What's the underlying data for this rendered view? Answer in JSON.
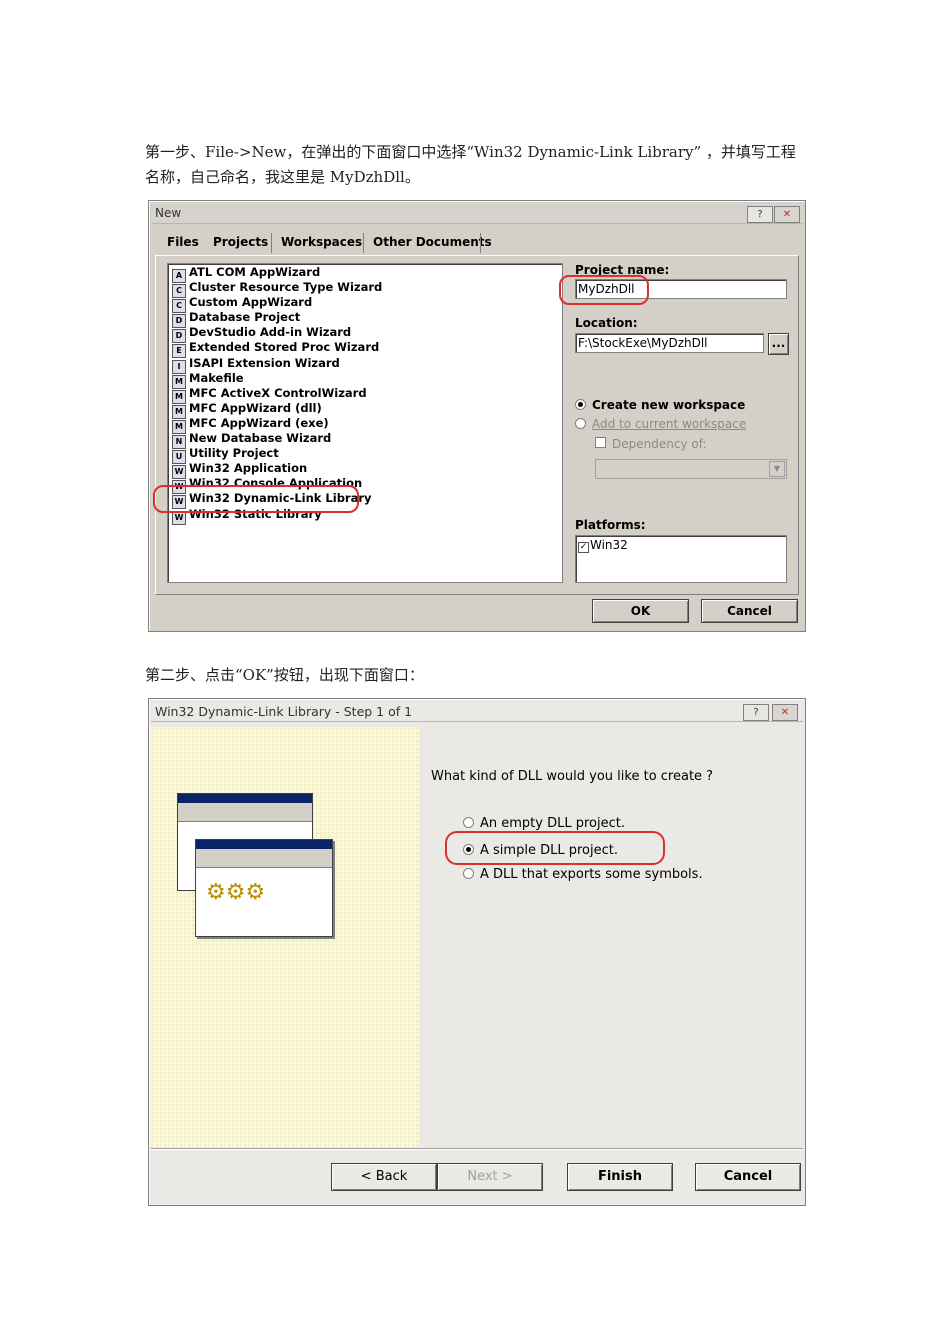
{
  "step1_text": "第一步、File->New，在弹出的下面窗口中选择“Win32 Dynamic-Link Library” ，并填写工程名称，自己命名，我这里是 MyDzhDll。",
  "step2_text": "第二步、点击“OK”按钮，出现下面窗口：",
  "new_dialog": {
    "title": "New",
    "help_btn": "?",
    "close_btn": "✕",
    "tabs": [
      "Files",
      "Projects",
      "Workspaces",
      "Other Documents"
    ],
    "projects": [
      "ATL COM AppWizard",
      "Cluster Resource Type Wizard",
      "Custom AppWizard",
      "Database Project",
      "DevStudio Add-in Wizard",
      "Extended Stored Proc Wizard",
      "ISAPI Extension Wizard",
      "Makefile",
      "MFC ActiveX ControlWizard",
      "MFC AppWizard (dll)",
      "MFC AppWizard (exe)",
      "New Database Wizard",
      "Utility Project",
      "Win32 Application",
      "Win32 Console Application",
      "Win32 Dynamic-Link Library",
      "Win32 Static Library"
    ],
    "project_name_label": "Project name:",
    "project_name_value": "MyDzhDll",
    "location_label": "Location:",
    "location_value": "F:\\StockExe\\MyDzhDll",
    "browse_btn": "...",
    "create_workspace": "Create new workspace",
    "add_workspace": "Add to current workspace",
    "dependency": "Dependency of:",
    "platforms_label": "Platforms:",
    "platform_item": "Win32",
    "ok_btn": "OK",
    "cancel_btn": "Cancel"
  },
  "wizard_dialog": {
    "title": "Win32 Dynamic-Link Library - Step 1 of 1",
    "help_btn": "?",
    "close_btn": "✕",
    "question": "What kind of DLL would you like to create ?",
    "options": [
      "An empty DLL project.",
      "A simple DLL project.",
      "A DLL that exports some symbols."
    ],
    "selected_option": 1,
    "back_btn": "< Back",
    "next_btn": "Next >",
    "finish_btn": "Finish",
    "cancel_btn": "Cancel"
  }
}
